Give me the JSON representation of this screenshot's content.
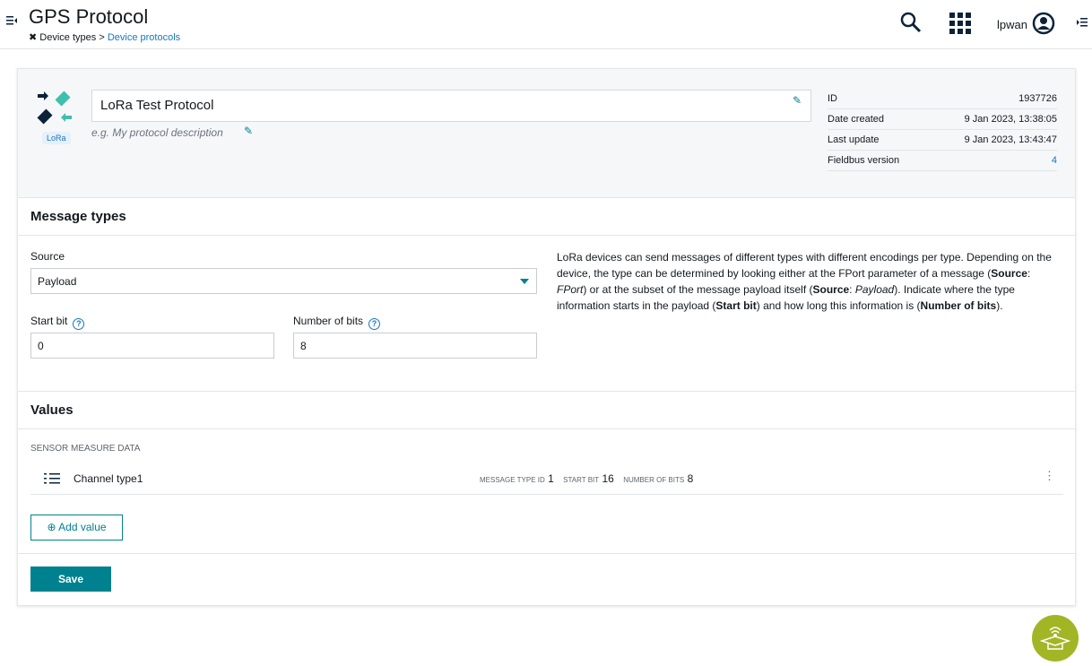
{
  "header": {
    "title": "GPS Protocol",
    "breadcrumb": {
      "parent": "Device types",
      "separator": ">",
      "current": "Device protocols"
    },
    "user": "lpwan"
  },
  "protocol": {
    "name": "LoRa Test Protocol",
    "description_placeholder": "e.g. My protocol description",
    "badge": "LoRa",
    "meta": [
      {
        "label": "ID",
        "value": "1937726"
      },
      {
        "label": "Date created",
        "value": "9 Jan 2023, 13:38:05"
      },
      {
        "label": "Last update",
        "value": "9 Jan 2023, 13:43:47"
      },
      {
        "label": "Fieldbus version",
        "value": "4"
      }
    ]
  },
  "message_types": {
    "title": "Message types",
    "source_label": "Source",
    "source_value": "Payload",
    "start_bit_label": "Start bit",
    "start_bit_value": "0",
    "num_bits_label": "Number of bits",
    "num_bits_value": "8",
    "help": {
      "p1": "LoRa devices can send messages of different types with different encodings per type. Depending on the device, the type can be determined by looking either at the FPort parameter of a message (",
      "source": "Source",
      "colon": ": ",
      "fport": "FPort",
      "p2": ") or at the subset of the message payload itself (",
      "payload": "Payload",
      "p3": "). Indicate where the type information starts in the payload (",
      "start_bit": "Start bit",
      "p4": ") and how long this information is (",
      "num_bits": "Number of bits",
      "p5": ")."
    }
  },
  "values": {
    "title": "Values",
    "group": "SENSOR MEASURE DATA",
    "items": [
      {
        "name": "Channel type1",
        "message_type_id_label": "MESSAGE TYPE ID",
        "message_type_id": "1",
        "start_bit_label": "START BIT",
        "start_bit": "16",
        "num_bits_label": "NUMBER OF BITS",
        "num_bits": "8"
      }
    ],
    "add_label": "Add value"
  },
  "save_label": "Save",
  "colors": {
    "accent": "#00818f",
    "link": "#1776bf",
    "navy": "#0b2239",
    "help_fab": "#a2b625"
  }
}
